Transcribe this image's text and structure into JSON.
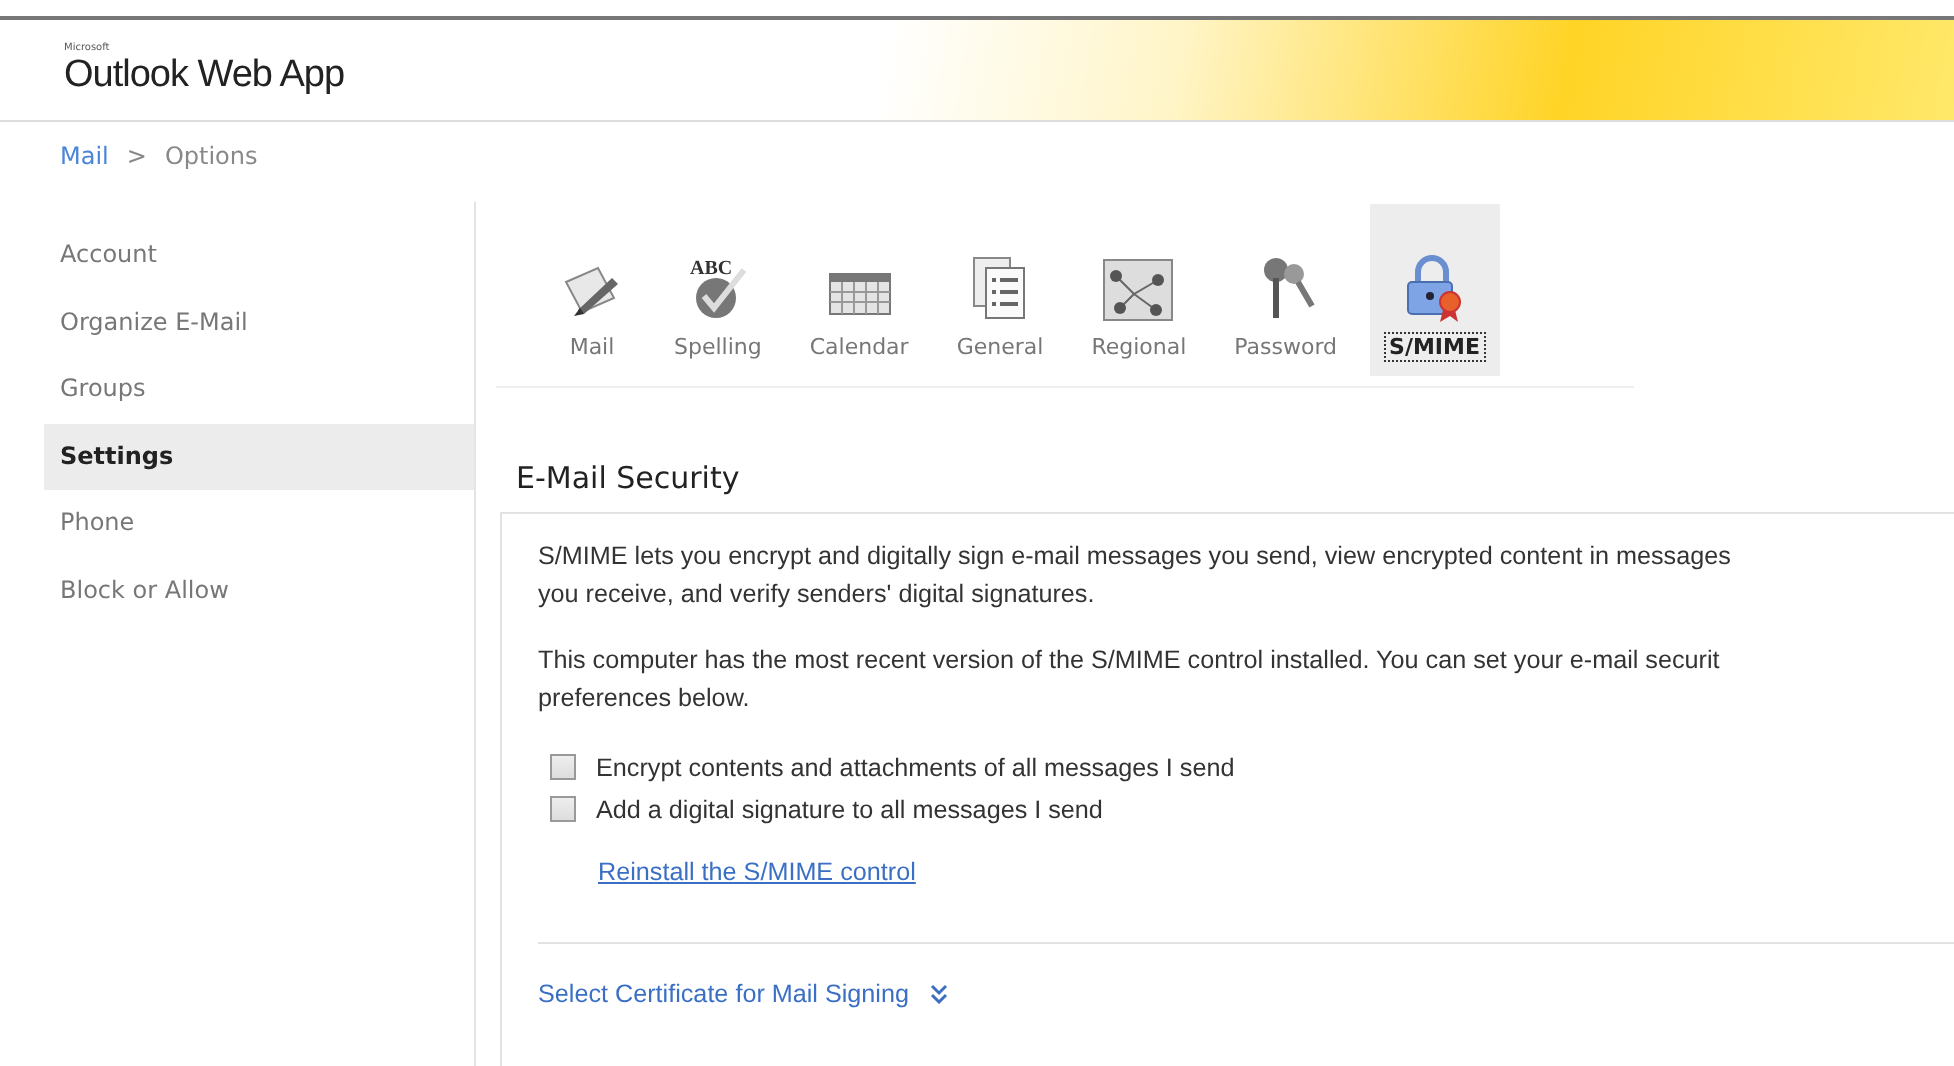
{
  "header": {
    "brand_small": "Microsoft",
    "brand": "Outlook Web App"
  },
  "breadcrumb": {
    "link": "Mail",
    "separator": ">",
    "current": "Options"
  },
  "sidebar": {
    "items": [
      {
        "label": "Account",
        "selected": false
      },
      {
        "label": "Organize E-Mail",
        "selected": false
      },
      {
        "label": "Groups",
        "selected": false
      },
      {
        "label": "Settings",
        "selected": true
      },
      {
        "label": "Phone",
        "selected": false
      },
      {
        "label": "Block or Allow",
        "selected": false
      }
    ]
  },
  "toolbar": [
    {
      "label": "Mail",
      "kind": "mail",
      "selected": false
    },
    {
      "label": "Spelling",
      "kind": "spelling",
      "icon_text": "ABC",
      "selected": false
    },
    {
      "label": "Calendar",
      "kind": "calendar",
      "selected": false
    },
    {
      "label": "General",
      "kind": "general",
      "selected": false
    },
    {
      "label": "Regional",
      "kind": "regional",
      "selected": false
    },
    {
      "label": "Password",
      "kind": "password",
      "selected": false
    },
    {
      "label": "S/MIME",
      "kind": "smime",
      "selected": true
    }
  ],
  "section": {
    "title": "E-Mail Security",
    "paragraphs": [
      [
        "S/MIME lets you encrypt and digitally sign e-mail messages you send, view encrypted content in messages",
        "you receive, and verify senders' digital signatures."
      ],
      [
        "This computer has the most recent version of the S/MIME control installed. You can set your e-mail securit",
        "preferences below."
      ]
    ],
    "options": [
      {
        "label": "Encrypt contents and attachments of all messages I send",
        "checked": false
      },
      {
        "label": "Add a digital signature to all messages I send",
        "checked": false
      }
    ],
    "link": "Reinstall the S/MIME control",
    "expander": {
      "label": "Select Certificate for Mail Signing",
      "expanded": false
    }
  }
}
